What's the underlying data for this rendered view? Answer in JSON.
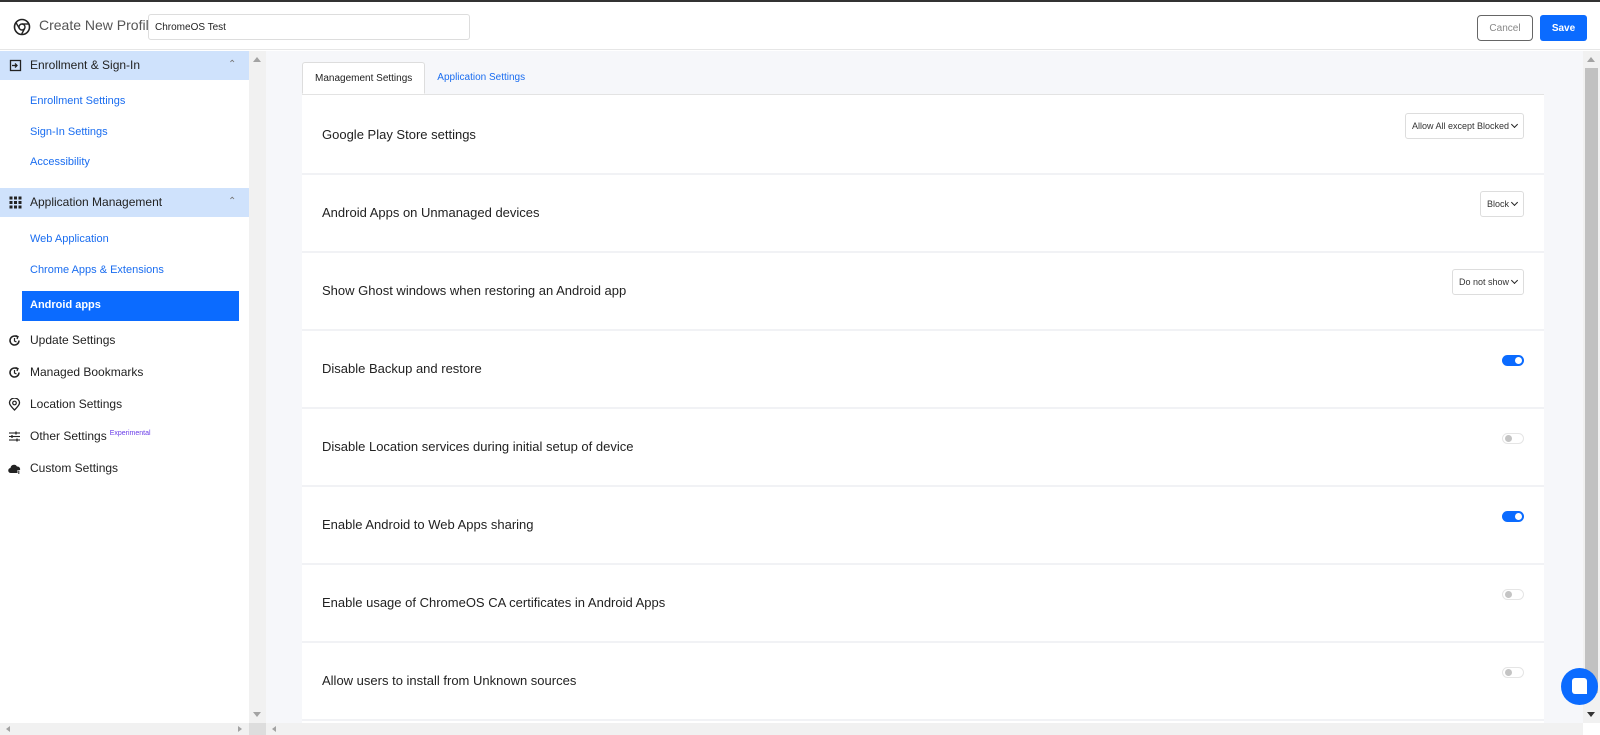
{
  "header": {
    "title": "Create New Profile",
    "profile_name": "ChromeOS Test",
    "cancel_label": "Cancel",
    "save_label": "Save"
  },
  "sidebar": {
    "groups": [
      {
        "label": "Enrollment & Sign-In",
        "icon": "login-icon",
        "expanded": true,
        "items": [
          "Enrollment Settings",
          "Sign-In Settings",
          "Accessibility"
        ]
      },
      {
        "label": "Application Management",
        "icon": "apps-grid-icon",
        "expanded": true,
        "items": [
          "Web Application",
          "Chrome Apps & Extensions",
          "Android apps"
        ],
        "active_item": "Android apps"
      }
    ],
    "nav_items": [
      {
        "label": "Update Settings",
        "icon": "update-icon"
      },
      {
        "label": "Managed Bookmarks",
        "icon": "bookmark-update-icon"
      },
      {
        "label": "Location Settings",
        "icon": "location-pin-icon"
      },
      {
        "label": "Other Settings",
        "icon": "sliders-icon",
        "badge": "Experimental"
      },
      {
        "label": "Custom Settings",
        "icon": "cloud-icon"
      }
    ]
  },
  "main": {
    "tabs": [
      {
        "label": "Management Settings",
        "active": true
      },
      {
        "label": "Application Settings",
        "active": false
      }
    ],
    "settings": [
      {
        "label": "Google Play Store settings",
        "type": "select",
        "value": "Allow All except Blocked"
      },
      {
        "label": "Android Apps on Unmanaged devices",
        "type": "select",
        "value": "Block"
      },
      {
        "label": "Show Ghost windows when restoring an Android app",
        "type": "select",
        "value": "Do not show"
      },
      {
        "label": "Disable Backup and restore",
        "type": "toggle",
        "value": true
      },
      {
        "label": "Disable Location services during initial setup of device",
        "type": "toggle",
        "value": false
      },
      {
        "label": "Enable Android to Web Apps sharing",
        "type": "toggle",
        "value": true
      },
      {
        "label": "Enable usage of ChromeOS CA certificates in Android Apps",
        "type": "toggle",
        "value": false
      },
      {
        "label": "Allow users to install from Unknown sources",
        "type": "toggle",
        "value": false
      }
    ]
  },
  "colors": {
    "accent": "#0b6bff",
    "sidebar_group_bg": "#cfe2fc",
    "link": "#1a6df0",
    "experimental_badge": "#6a3de8"
  }
}
